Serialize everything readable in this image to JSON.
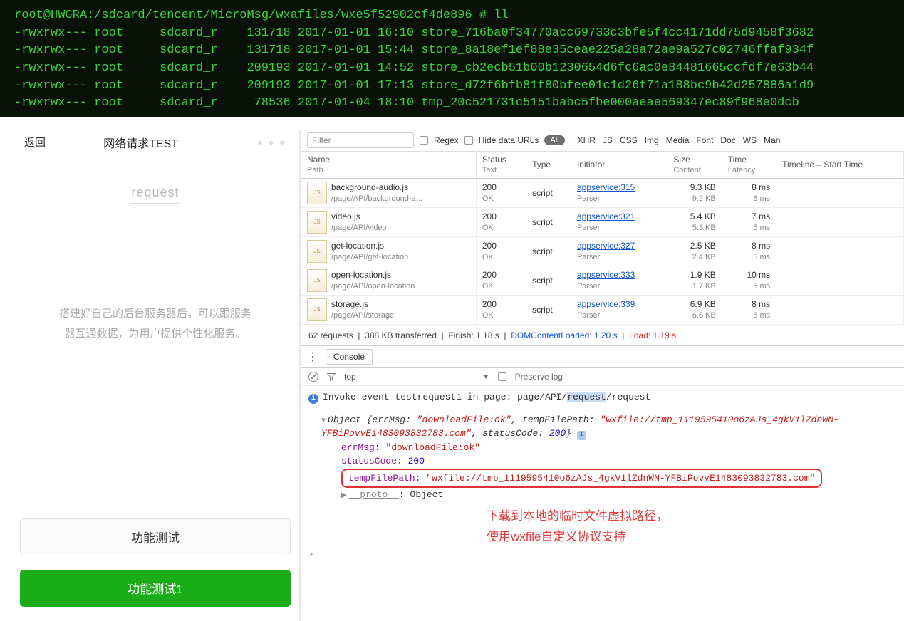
{
  "terminal": {
    "prompt": "root@HWGRA:/sdcard/tencent/MicroMsg/wxafiles/wxe5f52902cf4de896 # ll",
    "rows": [
      {
        "perm": "-rwxrwx---",
        "owner": "root",
        "group": "sdcard_r",
        "size": "131718",
        "date": "2017-01-01 16:10",
        "name": "store_716ba0f34770acc69733c3bfe5f4cc4171dd75d9458f3682"
      },
      {
        "perm": "-rwxrwx---",
        "owner": "root",
        "group": "sdcard_r",
        "size": "131718",
        "date": "2017-01-01 15:44",
        "name": "store_8a18ef1ef88e35ceae225a28a72ae9a527c02746ffaf934f"
      },
      {
        "perm": "-rwxrwx---",
        "owner": "root",
        "group": "sdcard_r",
        "size": "209193",
        "date": "2017-01-01 14:52",
        "name": "store_cb2ecb51b00b1230654d6fc6ac0e84481665ccfdf7e63b44"
      },
      {
        "perm": "-rwxrwx---",
        "owner": "root",
        "group": "sdcard_r",
        "size": "209193",
        "date": "2017-01-01 17:13",
        "name": "store_d72f6bfb81f80bfee01c1d26f71a188bc9b42d257886a1d9"
      },
      {
        "perm": "-rwxrwx---",
        "owner": "root",
        "group": "sdcard_r",
        "size": " 78536",
        "date": "2017-01-04 18:10",
        "name": "tmp_20c521731c5151babc5fbe000aeae569347ec89f968e0dcb"
      }
    ]
  },
  "phone": {
    "back": "返回",
    "title": "网络请求TEST",
    "dots": "● ● ●",
    "link": "request",
    "desc_l1": "搭建好自己的后台服务器后，可以跟服务",
    "desc_l2": "器互通数据，为用户提供个性化服务。",
    "btn1": "功能测试",
    "btn2": "功能测试1"
  },
  "filter": {
    "placeholder": "Filter",
    "regex": "Regex",
    "hide": "Hide data URLs",
    "all": "All",
    "types": [
      "XHR",
      "JS",
      "CSS",
      "Img",
      "Media",
      "Font",
      "Doc",
      "WS",
      "Man"
    ]
  },
  "net": {
    "head": {
      "name": "Name",
      "name2": "Path",
      "status": "Status",
      "status2": "Text",
      "type": "Type",
      "initiator": "Initiator",
      "size": "Size",
      "size2": "Content",
      "time": "Time",
      "time2": "Latency",
      "timeline": "Timeline – Start Time"
    },
    "rows": [
      {
        "name": "background-audio.js",
        "path": "/page/API/background-a...",
        "status": "200",
        "stext": "OK",
        "type": "script",
        "init": "appservice:315",
        "init2": "Parser",
        "size": "9.3 KB",
        "size2": "9.2 KB",
        "time": "8 ms",
        "time2": "6 ms"
      },
      {
        "name": "video.js",
        "path": "/page/API/video",
        "status": "200",
        "stext": "OK",
        "type": "script",
        "init": "appservice:321",
        "init2": "Parser",
        "size": "5.4 KB",
        "size2": "5.3 KB",
        "time": "7 ms",
        "time2": "5 ms"
      },
      {
        "name": "get-location.js",
        "path": "/page/API/get-location",
        "status": "200",
        "stext": "OK",
        "type": "script",
        "init": "appservice:327",
        "init2": "Parser",
        "size": "2.5 KB",
        "size2": "2.4 KB",
        "time": "8 ms",
        "time2": "5 ms"
      },
      {
        "name": "open-location.js",
        "path": "/page/API/open-location",
        "status": "200",
        "stext": "OK",
        "type": "script",
        "init": "appservice:333",
        "init2": "Parser",
        "size": "1.9 KB",
        "size2": "1.7 KB",
        "time": "10 ms",
        "time2": "5 ms"
      },
      {
        "name": "storage.js",
        "path": "/page/API/storage",
        "status": "200",
        "stext": "OK",
        "type": "script",
        "init": "appservice:339",
        "init2": "Parser",
        "size": "6.9 KB",
        "size2": "6.8 KB",
        "time": "8 ms",
        "time2": "5 ms"
      }
    ]
  },
  "summary": {
    "reqs": "62 requests",
    "xfer": "388 KB transferred",
    "finish": "Finish: 1.18 s",
    "dcl": "DOMContentLoaded: 1.20 s",
    "load": "Load: 1.19 s"
  },
  "console": {
    "tab": "Console",
    "top": "top",
    "preserve": "Preserve log",
    "info_pre": "Invoke event testrequest1 in page: page/API/",
    "info_hl": "request",
    "info_post": "/request",
    "obj_head1": "Object {errMsg: ",
    "obj_v1": "\"downloadFile:ok\"",
    "obj_head2": ", tempFilePath: ",
    "obj_v2": "\"wxfile://tmp_1119595410o6zAJs_4gkV1lZdnWN-YFBiPovvE1483093832783.com\"",
    "obj_head3": ", statusCode: ",
    "obj_v3": "200",
    "obj_head4": "}",
    "line_errmsg_k": "errMsg: ",
    "line_errmsg_v": "\"downloadFile:ok\"",
    "line_sc_k": "statusCode: ",
    "line_sc_v": "200",
    "line_tfp_k": "tempFilePath: ",
    "line_tfp_v": "\"wxfile://tmp_1119595410o6zAJs_4gkV1lZdnWN-YFBiPovvE1483093832783.com\"",
    "proto_k": "__proto__",
    "proto_v": ": Object",
    "annot1": "下载到本地的临时文件虚拟路径，",
    "annot2": "使用wxfile自定义协议支持"
  }
}
